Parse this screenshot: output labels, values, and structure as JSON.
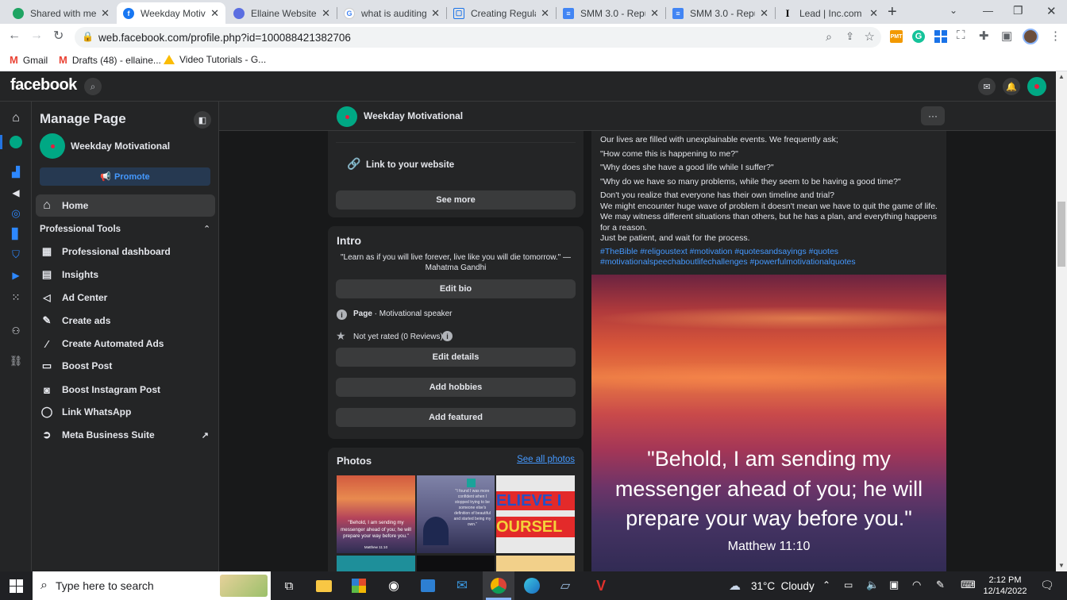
{
  "browser": {
    "tabs": [
      {
        "title": "Shared with me -",
        "icon": "google-drive-icon",
        "active": false
      },
      {
        "title": "Weekday Motivat",
        "icon": "facebook-icon",
        "active": true
      },
      {
        "title": "Ellaine Website P",
        "icon": "chrome-app-icon",
        "active": false
      },
      {
        "title": "what is auditing c",
        "icon": "google-icon",
        "active": false
      },
      {
        "title": "Creating Regular",
        "icon": "bookmark-icon",
        "active": false
      },
      {
        "title": "SMM 3.0 - Repur",
        "icon": "docs-icon",
        "active": false
      },
      {
        "title": "SMM 3.0 - Repur",
        "icon": "docs-icon",
        "active": false
      },
      {
        "title": "Lead | Inc.com",
        "icon": "inc-icon",
        "active": false
      }
    ],
    "url": "web.facebook.com/profile.php?id=100088421382706",
    "bookmarks": [
      {
        "label": "Gmail",
        "icon": "gmail-icon"
      },
      {
        "label": "Drafts (48) - ellaine...",
        "icon": "gmail-icon"
      },
      {
        "label": "Video Tutorials - G...",
        "icon": "google-drive-icon"
      }
    ]
  },
  "facebook": {
    "logo": "facebook",
    "page_name": "Weekday Motivational"
  },
  "sidebar": {
    "title": "Manage Page",
    "page_name": "Weekday Motivational",
    "promote_label": "Promote",
    "home_label": "Home",
    "section_label": "Professional Tools",
    "items": [
      {
        "label": "Professional dashboard",
        "icon": "dashboard-icon"
      },
      {
        "label": "Insights",
        "icon": "insights-icon"
      },
      {
        "label": "Ad Center",
        "icon": "megaphone-icon"
      },
      {
        "label": "Create ads",
        "icon": "pencil-icon"
      },
      {
        "label": "Create Automated Ads",
        "icon": "magic-wand-icon"
      },
      {
        "label": "Boost Post",
        "icon": "boost-icon"
      },
      {
        "label": "Boost Instagram Post",
        "icon": "instagram-icon"
      },
      {
        "label": "Link WhatsApp",
        "icon": "whatsapp-icon"
      },
      {
        "label": "Meta Business Suite",
        "icon": "meta-icon"
      }
    ]
  },
  "main": {
    "top_card": {
      "link_website": "Link to your website",
      "see_more": "See more"
    },
    "intro": {
      "title": "Intro",
      "bio": "\"Learn as if you will live forever, live like you will die tomorrow.\" — Mahatma Gandhi",
      "edit_bio": "Edit bio",
      "category_prefix": "Page",
      "category": " · Motivational speaker",
      "rating": "Not yet rated (0 Reviews)",
      "edit_details": "Edit details",
      "add_hobbies": "Add hobbies",
      "add_featured": "Add featured"
    },
    "photos": {
      "title": "Photos",
      "see_all": "See all photos",
      "thumb1_text": "\"Behold, I am sending my messenger ahead of you; he will prepare your way before you.\"",
      "thumb1_ref": "Matthew 11:10",
      "thumb2_text": "\"I found I was more confident when I stopped trying to be someone else's definition of beautiful and started being my own.\"",
      "thumb3_text_1": "ELIEVE I",
      "thumb3_text_2": "OURSEL"
    },
    "post": {
      "lines": [
        "Our lives are filled with unexplainable events. We frequently ask;",
        "\"How come this is happening to me?\"",
        "\"Why does she have a good life while I suffer?\"",
        "\"Why do we have so many problems, while they seem to be having a good time?\"",
        "Don't you realize that everyone has their own timeline and trial?",
        "We might encounter huge wave of problem it doesn't mean we have to quit the game of life.",
        "We may witness different situations than others, but he has a plan, and everything happens for a reason.",
        "Just be patient, and wait for the process."
      ],
      "hashtags": "#TheBible #religoustext #motivation #quotesandsayings #quotes #motivationalspeechaboutlifechallenges #powerfulmotivationalquotes",
      "image_quote": "\"Behold, I am sending my messenger ahead of you; he will prepare your way before you.\"",
      "image_ref": "Matthew 11:10"
    }
  },
  "taskbar": {
    "search_placeholder": "Type here to search",
    "weather": "31°C  Cloudy",
    "time": "2:12 PM",
    "date": "12/14/2022"
  },
  "colors": {
    "accent": "#2374e1",
    "brand_green": "#00a884",
    "link": "#4599ff"
  }
}
